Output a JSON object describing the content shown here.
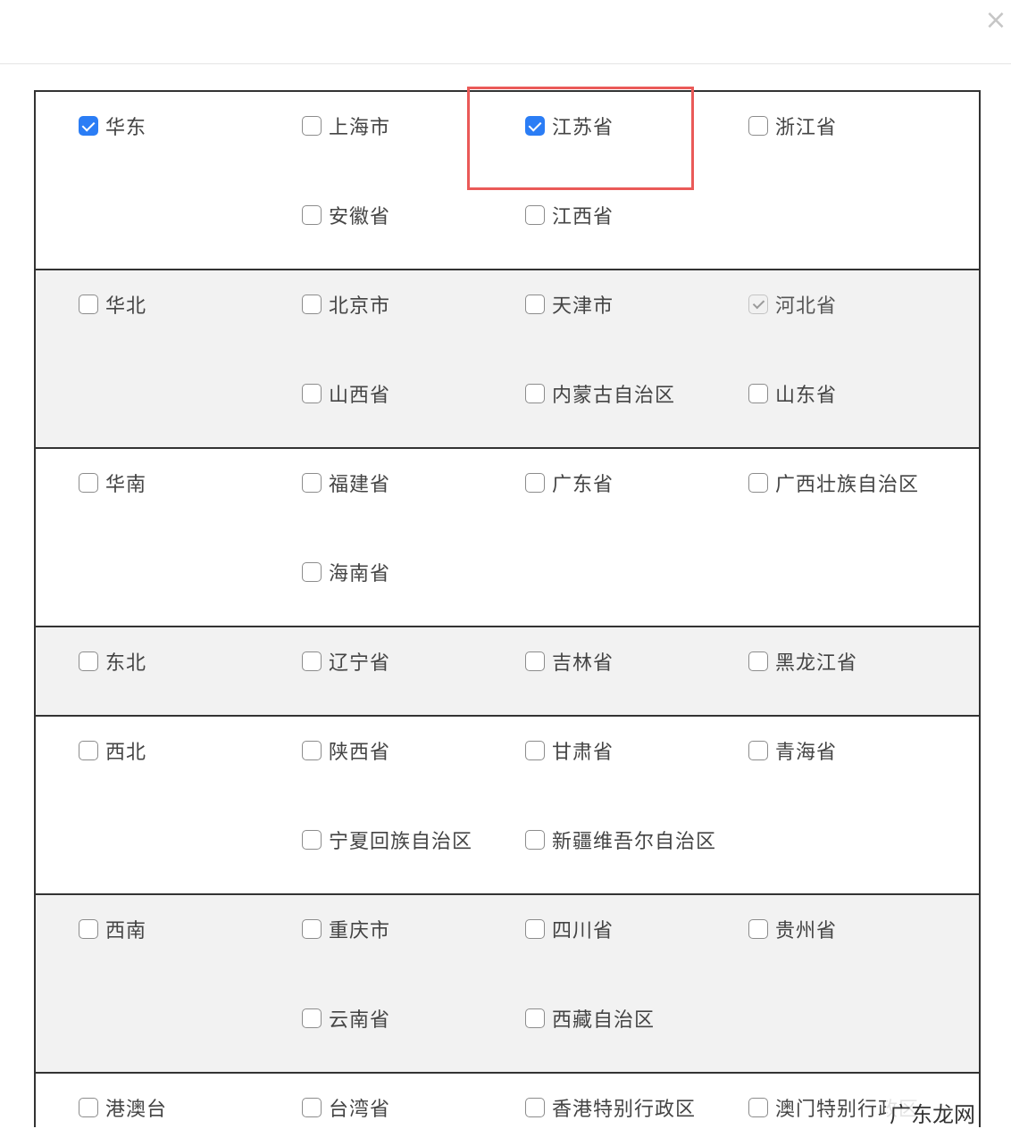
{
  "dialog": {
    "close_glyph": "×"
  },
  "regions": [
    {
      "name": "华东",
      "checked": true,
      "rows": [
        [
          {
            "label": "上海市",
            "state": "unchecked"
          },
          {
            "label": "江苏省",
            "state": "checked"
          },
          {
            "label": "浙江省",
            "state": "unchecked"
          }
        ],
        [
          {
            "label": "安徽省",
            "state": "unchecked"
          },
          {
            "label": "江西省",
            "state": "unchecked"
          }
        ]
      ]
    },
    {
      "name": "华北",
      "checked": false,
      "rows": [
        [
          {
            "label": "北京市",
            "state": "unchecked"
          },
          {
            "label": "天津市",
            "state": "unchecked"
          },
          {
            "label": "河北省",
            "state": "disabled-checked"
          }
        ],
        [
          {
            "label": "山西省",
            "state": "unchecked"
          },
          {
            "label": "内蒙古自治区",
            "state": "unchecked"
          },
          {
            "label": "山东省",
            "state": "unchecked"
          }
        ]
      ]
    },
    {
      "name": "华南",
      "checked": false,
      "rows": [
        [
          {
            "label": "福建省",
            "state": "unchecked"
          },
          {
            "label": "广东省",
            "state": "unchecked"
          },
          {
            "label": "广西壮族自治区",
            "state": "unchecked"
          }
        ],
        [
          {
            "label": "海南省",
            "state": "unchecked"
          }
        ]
      ]
    },
    {
      "name": "东北",
      "checked": false,
      "rows": [
        [
          {
            "label": "辽宁省",
            "state": "unchecked"
          },
          {
            "label": "吉林省",
            "state": "unchecked"
          },
          {
            "label": "黑龙江省",
            "state": "unchecked"
          }
        ]
      ]
    },
    {
      "name": "西北",
      "checked": false,
      "rows": [
        [
          {
            "label": "陕西省",
            "state": "unchecked"
          },
          {
            "label": "甘肃省",
            "state": "unchecked"
          },
          {
            "label": "青海省",
            "state": "unchecked"
          }
        ],
        [
          {
            "label": "宁夏回族自治区",
            "state": "unchecked"
          },
          {
            "label": "新疆维吾尔自治区",
            "state": "unchecked"
          }
        ]
      ]
    },
    {
      "name": "西南",
      "checked": false,
      "rows": [
        [
          {
            "label": "重庆市",
            "state": "unchecked"
          },
          {
            "label": "四川省",
            "state": "unchecked"
          },
          {
            "label": "贵州省",
            "state": "unchecked"
          }
        ],
        [
          {
            "label": "云南省",
            "state": "unchecked"
          },
          {
            "label": "西藏自治区",
            "state": "unchecked"
          }
        ]
      ]
    },
    {
      "name": "港澳台",
      "checked": false,
      "rows": [
        [
          {
            "label": "台湾省",
            "state": "unchecked"
          },
          {
            "label": "香港特别行政区",
            "state": "unchecked"
          },
          {
            "label": "澳门特别行政区",
            "state": "unchecked"
          }
        ]
      ]
    }
  ],
  "highlighted_item": "江苏省",
  "colors": {
    "checkbox_checked": "#2b7df5",
    "highlight_border": "#ea5a58",
    "alt_row_bg": "#f2f2f2"
  },
  "watermark": "广东龙网"
}
